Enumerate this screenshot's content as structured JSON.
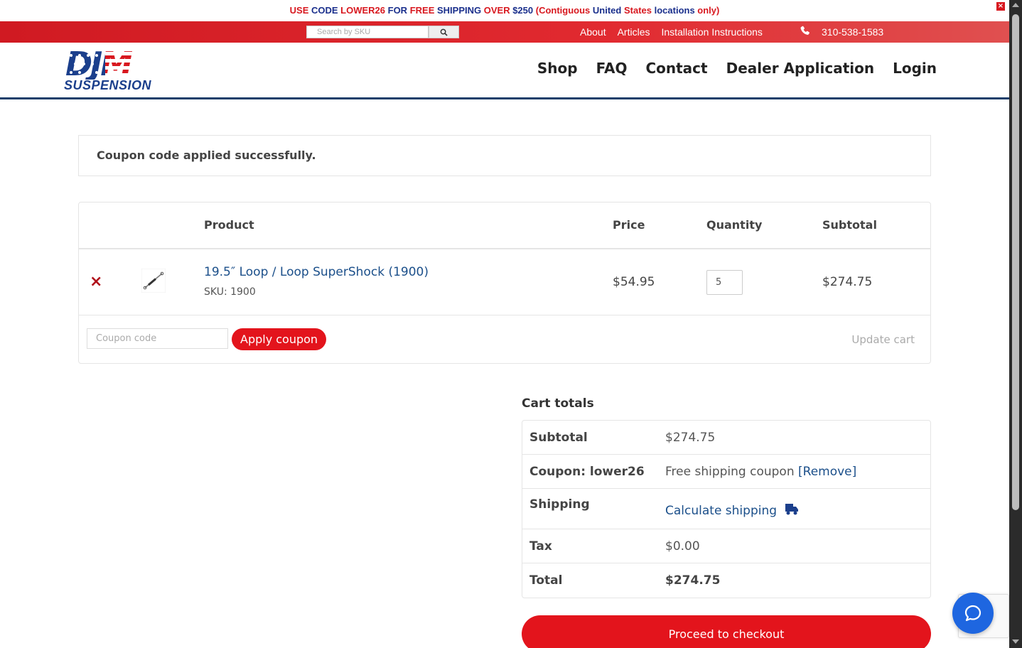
{
  "announcement": {
    "parts": [
      {
        "text": "USE ",
        "color": "r"
      },
      {
        "text": "CODE ",
        "color": "b"
      },
      {
        "text": "LOWER26 ",
        "color": "r"
      },
      {
        "text": "FOR ",
        "color": "b"
      },
      {
        "text": "FREE ",
        "color": "r"
      },
      {
        "text": "SHIPPING ",
        "color": "b"
      },
      {
        "text": "OVER ",
        "color": "r"
      },
      {
        "text": "$250 ",
        "color": "b"
      },
      {
        "text": "(Contiguous ",
        "color": "r"
      },
      {
        "text": "United ",
        "color": "b"
      },
      {
        "text": "States ",
        "color": "r"
      },
      {
        "text": "locations ",
        "color": "b"
      },
      {
        "text": "only)",
        "color": "r"
      }
    ],
    "close_label": "×"
  },
  "utility": {
    "search_placeholder": "Search by SKU",
    "links": [
      "About",
      "Articles",
      "Installation Instructions"
    ],
    "phone": "310-538-1583"
  },
  "logo": {
    "top": "DJM",
    "bottom": "SUSPENSION"
  },
  "nav": [
    "Shop",
    "FAQ",
    "Contact",
    "Dealer Application",
    "Login"
  ],
  "notice": "Coupon code applied successfully.",
  "cart": {
    "headers": {
      "product": "Product",
      "price": "Price",
      "quantity": "Quantity",
      "subtotal": "Subtotal"
    },
    "items": [
      {
        "name": "19.5″ Loop / Loop SuperShock (1900)",
        "sku": "SKU: 1900",
        "price": "$54.95",
        "quantity": "5",
        "subtotal": "$274.75",
        "remove": "×"
      }
    ],
    "coupon_placeholder": "Coupon code",
    "apply_label": "Apply coupon",
    "update_label": "Update cart"
  },
  "totals": {
    "title": "Cart totals",
    "subtotal_label": "Subtotal",
    "subtotal_value": "$274.75",
    "coupon_label": "Coupon: lower26",
    "coupon_value": "Free shipping coupon",
    "coupon_remove": "[Remove]",
    "shipping_label": "Shipping",
    "shipping_value": "Calculate shipping",
    "tax_label": "Tax",
    "tax_value": "$0.00",
    "total_label": "Total",
    "total_value": "$274.75"
  },
  "checkout_label": "Proceed to checkout",
  "colors": {
    "brand_red": "#e3141c",
    "brand_blue": "#1b3f8c",
    "link": "#1b4f8a"
  }
}
